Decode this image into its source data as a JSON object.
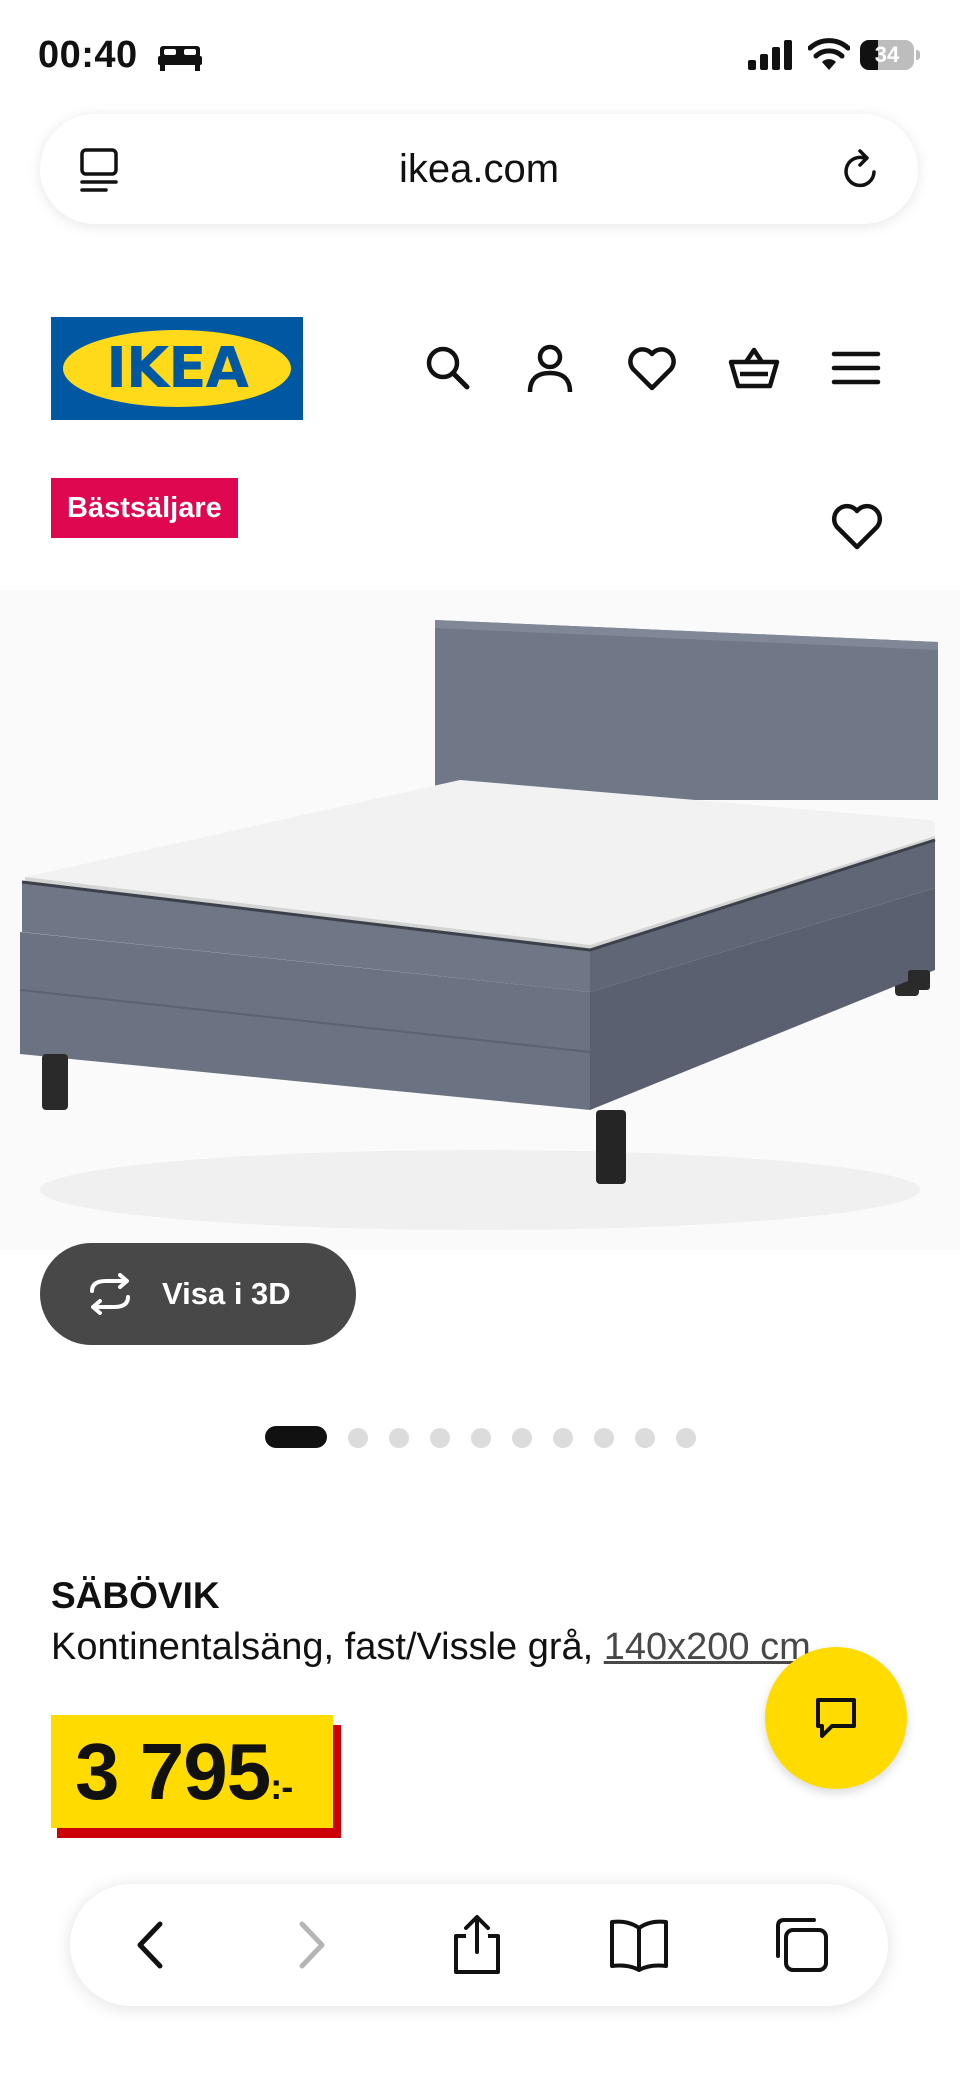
{
  "status_bar": {
    "time": "00:40",
    "battery_level": "34",
    "icons": [
      "bed-icon",
      "signal-icon",
      "wifi-icon",
      "battery-icon"
    ]
  },
  "browser": {
    "url": "ikea.com",
    "icons": [
      "tabs-icon",
      "reload-icon"
    ]
  },
  "header": {
    "logo_text": "IKEA",
    "nav_icons": [
      "search-icon",
      "account-icon",
      "favourites-icon",
      "cart-icon",
      "menu-icon"
    ],
    "brand_colors": {
      "blue": "#0058a3",
      "yellow": "#ffda1a"
    }
  },
  "product": {
    "badge": "Bästsäljare",
    "badge_color": "#e00751",
    "view_3d_label": "Visa i 3D",
    "image_count": 10,
    "active_image_index": 0,
    "name": "SÄBÖVIK",
    "description": "Kontinentalsäng, fast/Vissle grå, ",
    "size": "140x200 cm",
    "price": "3 795",
    "price_suffix": ":-",
    "price_colors": {
      "background": "#ffdb00",
      "shadow": "#cc0008"
    }
  },
  "chat": {
    "icon": "chat-icon"
  },
  "bottom_toolbar": {
    "icons": [
      "back-icon",
      "forward-icon",
      "share-icon",
      "bookmarks-icon",
      "tabs-overview-icon"
    ]
  }
}
